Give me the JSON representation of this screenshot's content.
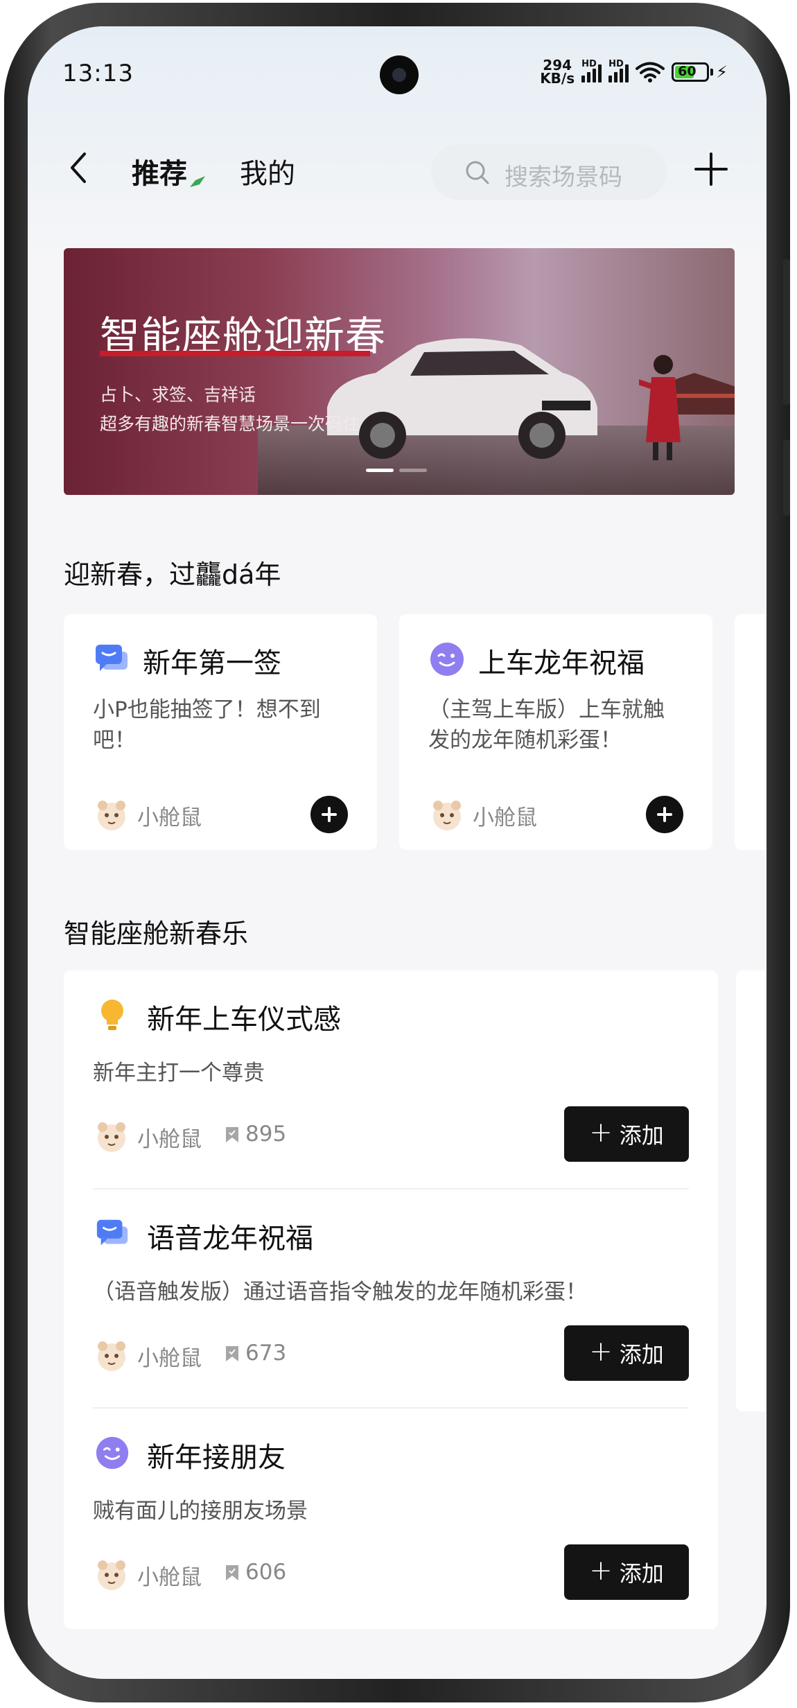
{
  "status": {
    "time": "13:13",
    "net_speed_top": "294",
    "net_speed_unit": "KB/s",
    "signal1_label": "HD",
    "signal2_label": "HD",
    "battery": "60"
  },
  "header": {
    "tabs": [
      {
        "label": "推荐",
        "active": true
      },
      {
        "label": "我的",
        "active": false
      }
    ],
    "search_placeholder": "搜索场景码"
  },
  "banner": {
    "title": "智能座舱迎新春",
    "line1": "占卜、求签、吉祥话",
    "line2": "超多有趣的新春智慧场景一次码住",
    "accent": "#c81c2a"
  },
  "section1": {
    "title": "迎新春，过龘dá年",
    "cards": [
      {
        "title": "新年第一签",
        "desc": "小P也能抽签了！想不到吧！",
        "author": "小舱鼠",
        "icon": "chat-bubble-icon"
      },
      {
        "title": "上车龙年祝福",
        "desc": "（主驾上车版）上车就触发的龙年随机彩蛋！",
        "author": "小舱鼠",
        "icon": "wink-face-icon"
      }
    ]
  },
  "section2": {
    "title": "智能座舱新春乐",
    "items": [
      {
        "title": "新年上车仪式感",
        "desc": "新年主打一个尊贵",
        "author": "小舱鼠",
        "count": "895",
        "button": "添加",
        "icon": "lightbulb-icon"
      },
      {
        "title": "语音龙年祝福",
        "desc": "（语音触发版）通过语音指令触发的龙年随机彩蛋！",
        "author": "小舱鼠",
        "count": "673",
        "button": "添加",
        "icon": "chat-bubble-icon"
      },
      {
        "title": "新年接朋友",
        "desc": "贼有面儿的接朋友场景",
        "author": "小舱鼠",
        "count": "606",
        "button": "添加",
        "icon": "wink-face-icon"
      }
    ]
  },
  "colors": {
    "accent_green": "#3aa657",
    "button_bg": "#141414",
    "purple_icon": "#8f7ef0",
    "blue_icon": "#4f7cf6",
    "yellow_icon": "#f7b733"
  }
}
